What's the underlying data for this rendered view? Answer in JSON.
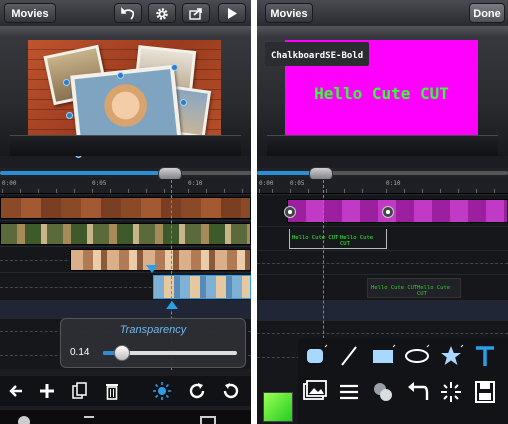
{
  "left": {
    "topbar": {
      "back_label": "Movies",
      "buttons": [
        "undo-icon",
        "gear-icon",
        "share-icon",
        "play-icon"
      ]
    },
    "timeline_ticks": [
      "0:00",
      "0:05",
      "0:10"
    ],
    "transparency": {
      "title": "Transparency",
      "value_label": "0.14",
      "value": 0.14
    },
    "bottom_toolbar": [
      "arrow-left-icon",
      "plus-icon",
      "copy-icon",
      "trash-icon",
      "brightness-icon",
      "redo-icon",
      "undo-icon"
    ]
  },
  "right": {
    "topbar": {
      "back_label": "Movies",
      "done_label": "Done"
    },
    "font_label": "ChalkboardSE-Bold",
    "preview_text": "Hello Cute CUT",
    "colors": {
      "preview_bg": "#ff00ff",
      "preview_text": "#33ff33",
      "accent": "#2a8fd8",
      "text_track": "#9c1fa0"
    },
    "timeline_ticks": [
      "0:00",
      "0:05",
      "0:10"
    ],
    "text_clip_labels": [
      "Hello Cute CUT",
      "Hello Cute CUT"
    ],
    "text_clip_labels_2": [
      "Hello Cute CUT",
      "Hello Cute CUT"
    ],
    "tools_row1": [
      "rounded-rect-icon",
      "line-icon",
      "rect-icon",
      "ellipse-icon",
      "star-icon",
      "text-tool-icon"
    ],
    "tools_row2": [
      "image-icon",
      "menu-lines-icon",
      "layers-icon",
      "undo-icon",
      "sparkle-icon",
      "save-icon"
    ]
  }
}
